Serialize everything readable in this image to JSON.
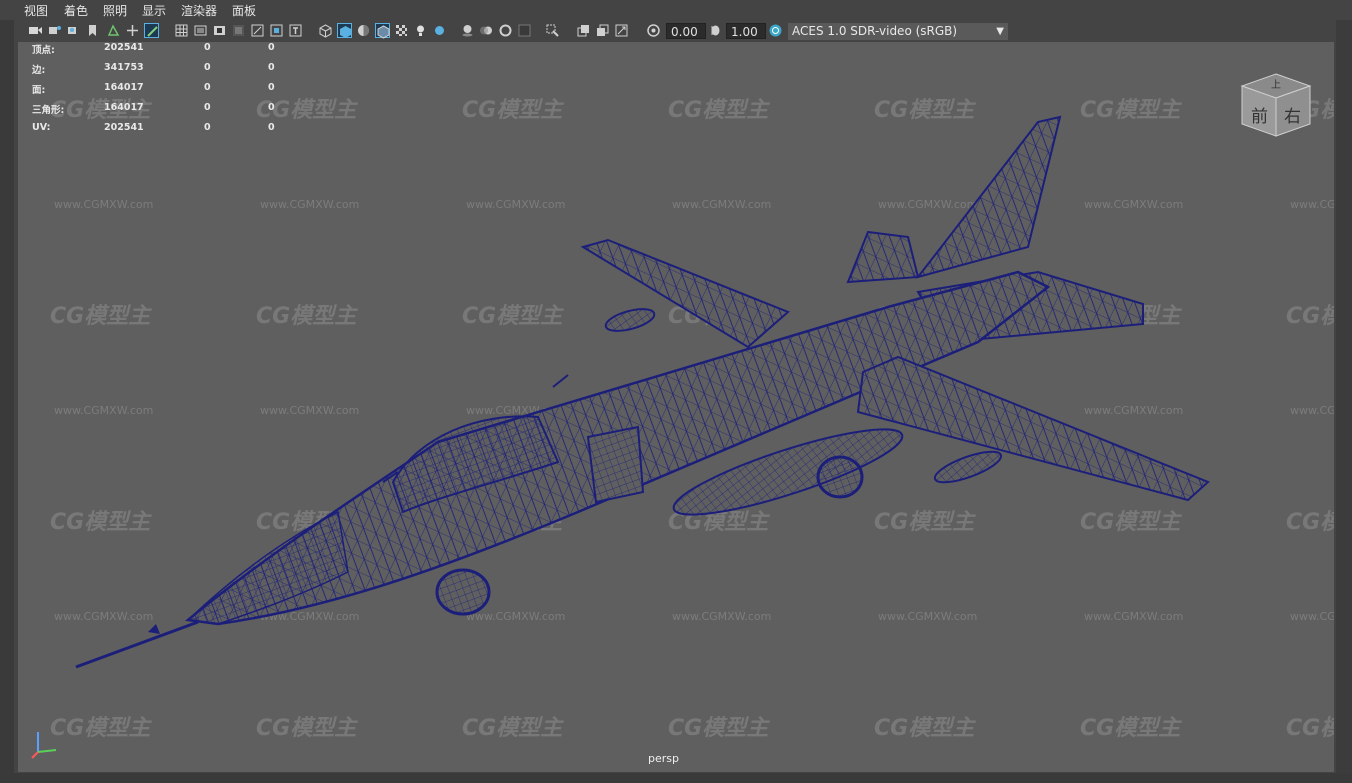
{
  "menu": [
    "视图",
    "着色",
    "照明",
    "显示",
    "渲染器",
    "面板"
  ],
  "toolbar": {
    "exposure": "0.00",
    "gamma": "1.00",
    "color_space": "ACES 1.0 SDR-video (sRGB)"
  },
  "hud": {
    "rows": [
      {
        "label": "顶点:",
        "v1": "202541",
        "v2": "0",
        "v3": "0"
      },
      {
        "label": "边:",
        "v1": "341753",
        "v2": "0",
        "v3": "0"
      },
      {
        "label": "面:",
        "v1": "164017",
        "v2": "0",
        "v3": "0"
      },
      {
        "label": "三角形:",
        "v1": "164017",
        "v2": "0",
        "v3": "0"
      },
      {
        "label": "UV:",
        "v1": "202541",
        "v2": "0",
        "v3": "0"
      }
    ]
  },
  "viewcube": {
    "front": "前",
    "right": "右",
    "top": "上"
  },
  "camera_label": "persp",
  "watermark": {
    "brand": "CG模型主",
    "url": "www.CGMXW.com"
  },
  "colors": {
    "viewport_bg": "#5f5f5f",
    "wireframe": "#1c1f7a",
    "accent": "#5ab0e0"
  }
}
